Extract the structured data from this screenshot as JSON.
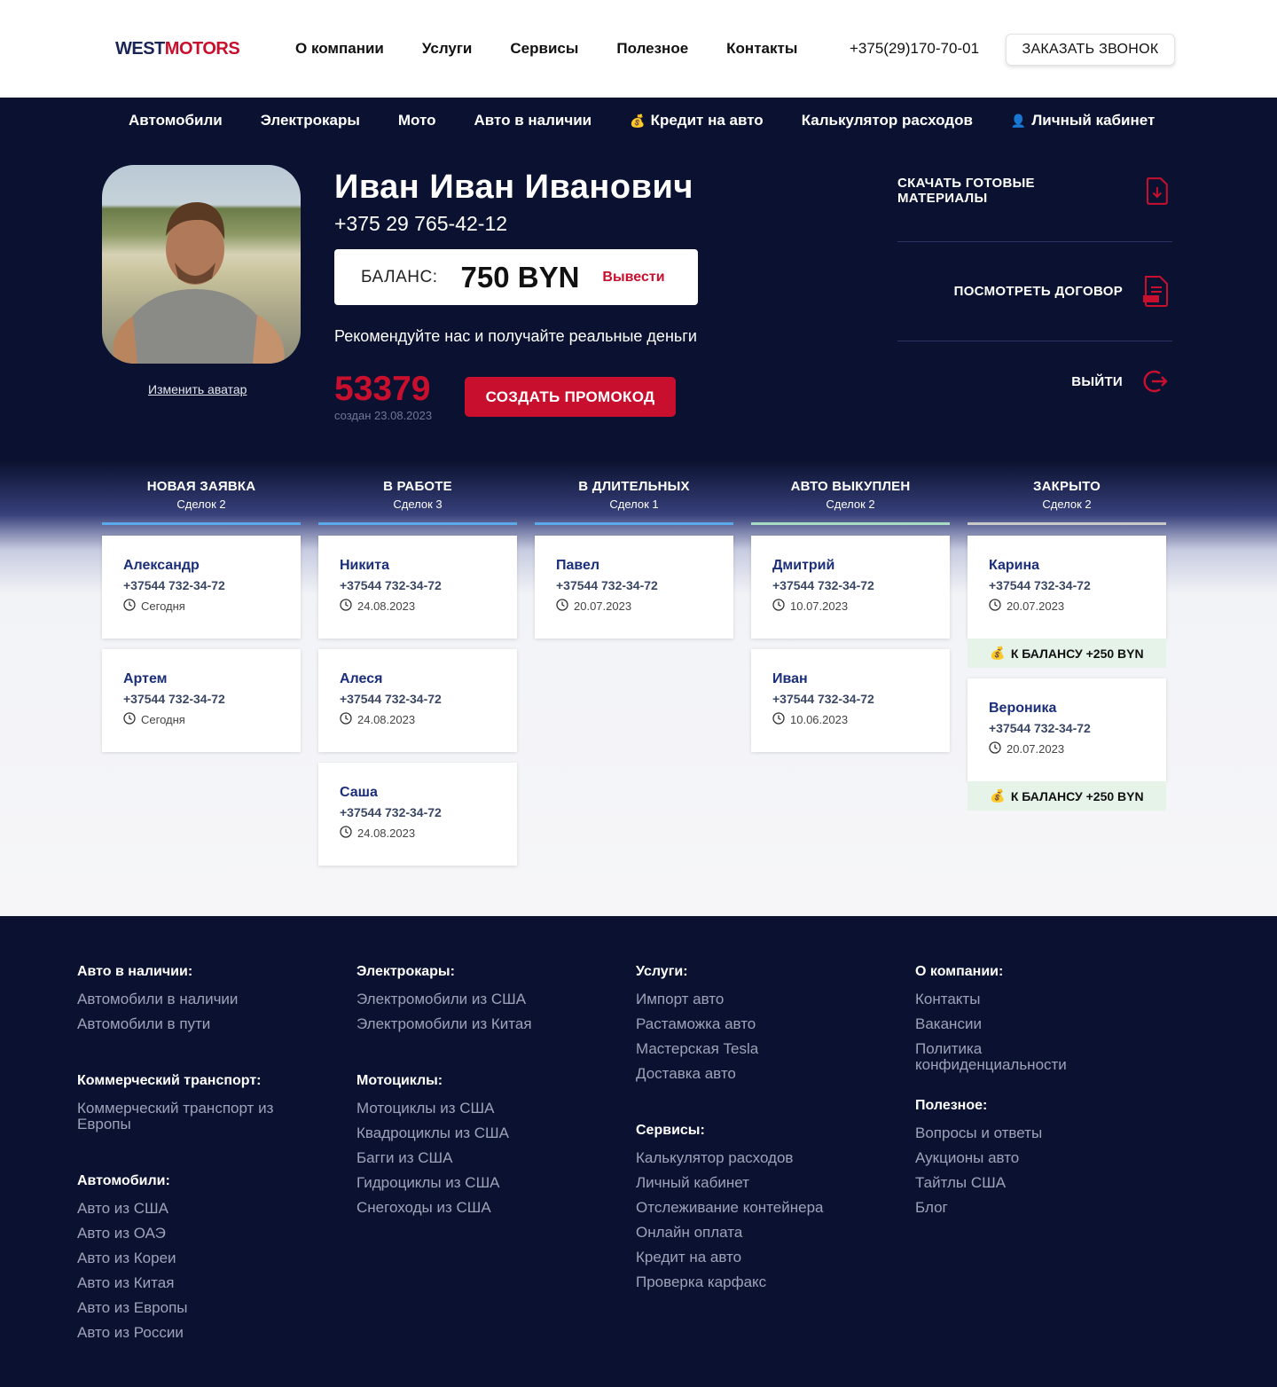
{
  "header": {
    "logo_west": "WEST",
    "logo_motors": "MOTORS",
    "nav": [
      "О компании",
      "Услуги",
      "Сервисы",
      "Полезное",
      "Контакты"
    ],
    "phone": "+375(29)170-70-01",
    "callback_label": "ЗАКАЗАТЬ ЗВОНОК"
  },
  "subnav": {
    "items": [
      {
        "label": "Автомобили"
      },
      {
        "label": "Электрокары"
      },
      {
        "label": "Мото"
      },
      {
        "label": "Авто в наличии"
      },
      {
        "label": "Кредит на авто",
        "icon": "money-bag-icon"
      },
      {
        "label": "Калькулятор расходов"
      },
      {
        "label": "Личный кабинет",
        "icon": "user-icon"
      }
    ]
  },
  "profile": {
    "name": "Иван Иван Иванович",
    "phone": "+375 29 765-42-12",
    "change_avatar": "Изменить аватар",
    "balance_label": "БАЛАНС:",
    "balance_value": "750 BYN",
    "withdraw": "Вывести",
    "recommend": "Рекомендуйте нас и получайте реальные деньги",
    "promo_code": "53379",
    "promo_date": "создан 23.08.2023",
    "create_promo": "СОЗДАТЬ ПРОМОКОД"
  },
  "actions": {
    "download": "СКАЧАТЬ ГОТОВЫЕ МАТЕРИАЛЫ",
    "contract": "ПОСМОТРЕТЬ ДОГОВОР",
    "logout": "ВЫЙТИ",
    "accent_color": "#c8102e"
  },
  "kanban": {
    "columns": [
      {
        "title": "НОВАЯ ЗАЯВКА",
        "count": "Сделок 2",
        "color": "#5aa9ea",
        "cards": [
          {
            "name": "Александр",
            "phone": "+37544 732-34-72",
            "date": "Сегодня"
          },
          {
            "name": "Артем",
            "phone": "+37544 732-34-72",
            "date": "Сегодня"
          }
        ]
      },
      {
        "title": "В РАБОТЕ",
        "count": "Сделок 3",
        "color": "#5aa9ea",
        "cards": [
          {
            "name": "Никита",
            "phone": "+37544 732-34-72",
            "date": "24.08.2023"
          },
          {
            "name": "Алеся",
            "phone": "+37544 732-34-72",
            "date": "24.08.2023"
          },
          {
            "name": "Саша",
            "phone": "+37544 732-34-72",
            "date": "24.08.2023"
          }
        ]
      },
      {
        "title": "В ДЛИТЕЛЬНЫХ",
        "count": "Сделок 1",
        "color": "#5aa9ea",
        "cards": [
          {
            "name": "Павел",
            "phone": "+37544 732-34-72",
            "date": "20.07.2023"
          }
        ]
      },
      {
        "title": "АВТО ВЫКУПЛЕН",
        "count": "Сделок 2",
        "color": "#a8dcc4",
        "cards": [
          {
            "name": "Дмитрий",
            "phone": "+37544 732-34-72",
            "date": "10.07.2023"
          },
          {
            "name": "Иван",
            "phone": "+37544 732-34-72",
            "date": "10.06.2023"
          }
        ]
      },
      {
        "title": "ЗАКРЫТО",
        "count": "Сделок 2",
        "color": "#c9c9c9",
        "cards": [
          {
            "name": "Карина",
            "phone": "+37544 732-34-72",
            "date": "20.07.2023",
            "bonus": "К БАЛАНСУ +250 BYN"
          },
          {
            "name": "Вероника",
            "phone": "+37544 732-34-72",
            "date": "20.07.2023",
            "bonus": "К БАЛАНСУ +250 BYN"
          }
        ]
      }
    ]
  },
  "footer": {
    "col1": [
      {
        "title": "Авто в наличии:",
        "links": [
          "Автомобили в наличии",
          "Автомобили в пути"
        ]
      },
      {
        "title": "Коммерческий транспорт:",
        "links": [
          "Коммерческий транспорт из Европы"
        ]
      },
      {
        "title": "Автомобили:",
        "links": [
          "Авто из США",
          "Авто из ОАЭ",
          "Авто из Кореи",
          "Авто из Китая",
          "Авто из Европы",
          "Авто из России"
        ]
      }
    ],
    "col2": [
      {
        "title": "Электрокары:",
        "links": [
          "Электромобили из США",
          "Электромобили из Китая"
        ]
      },
      {
        "title": "Мотоциклы:",
        "links": [
          "Мотоциклы из США",
          "Квадроциклы из США",
          "Багги из США",
          "Гидроциклы из США",
          "Снегоходы из США"
        ]
      }
    ],
    "col3": [
      {
        "title": "Услуги:",
        "links": [
          "Импорт авто",
          "Растаможка авто",
          "Мастерская Tesla",
          "Доставка авто"
        ]
      },
      {
        "title": "Сервисы:",
        "links": [
          "Калькулятор расходов",
          "Личный кабинет",
          "Отслеживание контейнера",
          "Онлайн оплата",
          "Кредит на авто",
          "Проверка карфакс"
        ]
      }
    ],
    "col4": [
      {
        "title": "О компании:",
        "links": [
          "Контакты",
          "Вакансии",
          "Политика конфиденциальности"
        ]
      },
      {
        "title": "Полезное:",
        "links": [
          "Вопросы и ответы",
          "Аукционы авто",
          "Тайтлы США",
          "Блог"
        ]
      }
    ]
  }
}
